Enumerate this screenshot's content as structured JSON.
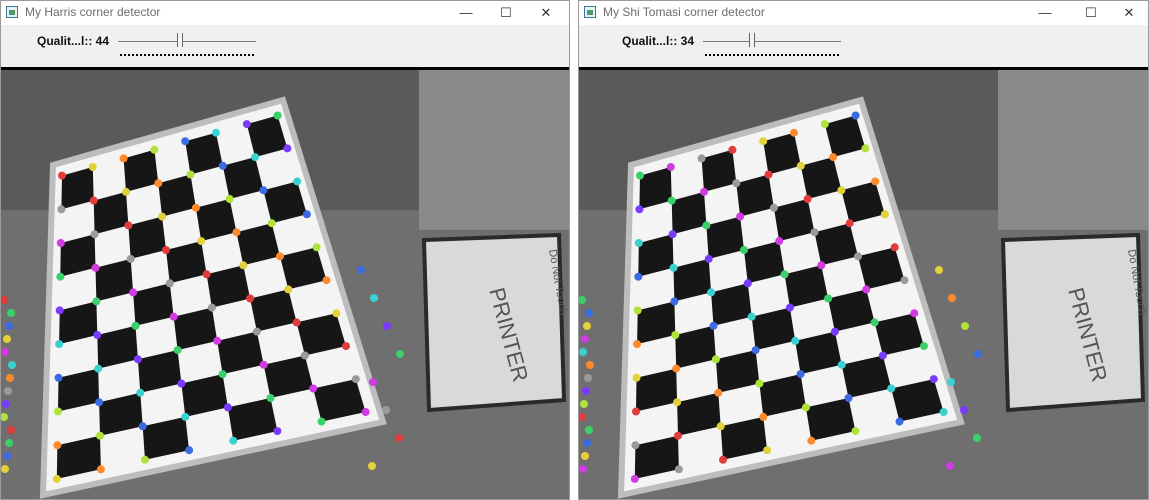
{
  "windows": [
    {
      "title": "My Harris corner detector",
      "trackbar_label": "Qualit...l:: 44",
      "trackbar_value": 44,
      "trackbar_max": 100
    },
    {
      "title": "My Shi Tomasi corner detector",
      "trackbar_label": "Qualit...l:: 34",
      "trackbar_value": 34,
      "trackbar_max": 100
    }
  ],
  "controls": {
    "minimize": "—",
    "maximize": "☐",
    "close": "✕"
  },
  "scene": {
    "background_colors": [
      "#6f6f6f",
      "#5a5a5a",
      "#8a8a8a"
    ],
    "board_colors": {
      "light": "#f4f4f4",
      "dark": "#161616"
    },
    "whiteboard_text": [
      "Do Not Touch",
      "PRINTER"
    ],
    "corner_marker_colors": [
      "#e23b3b",
      "#3bd16a",
      "#3b6ae2",
      "#e2d13b",
      "#d13be2",
      "#3bd1d1",
      "#ff8a2b",
      "#9a9a9a",
      "#7a3bff",
      "#b0e23b"
    ]
  }
}
